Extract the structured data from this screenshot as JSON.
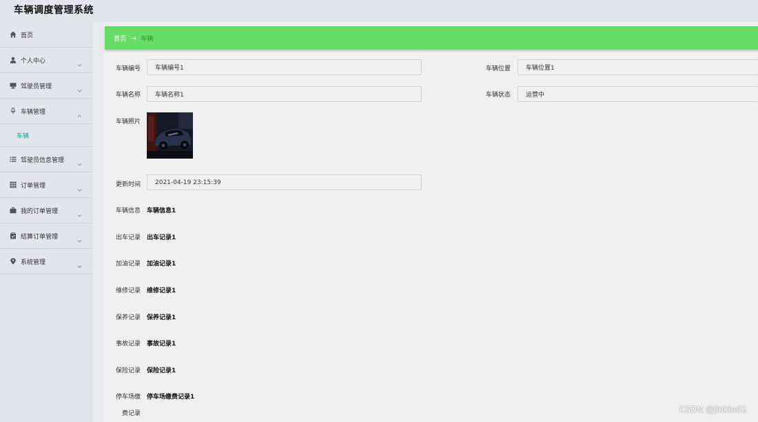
{
  "app": {
    "title": "车辆调度管理系统"
  },
  "sidebar": {
    "items": [
      {
        "label": "首页",
        "icon": "home-icon"
      },
      {
        "label": "个人中心",
        "icon": "user-icon"
      },
      {
        "label": "驾驶员管理",
        "icon": "monitor-icon"
      },
      {
        "label": "车辆管理",
        "icon": "microphone-icon"
      },
      {
        "label": "车辆",
        "sub": true
      },
      {
        "label": "驾驶员信息管理",
        "icon": "list-icon"
      },
      {
        "label": "订单管理",
        "icon": "grid-icon"
      },
      {
        "label": "我的订单管理",
        "icon": "briefcase-icon"
      },
      {
        "label": "结算订单管理",
        "icon": "clipboard-icon"
      },
      {
        "label": "系统管理",
        "icon": "location-pin-icon"
      }
    ]
  },
  "breadcrumb": {
    "home": "首页",
    "arrow": "→",
    "current": "车辆"
  },
  "form": {
    "vehicle_no": {
      "label": "车辆编号",
      "value": "车辆编号1"
    },
    "vehicle_pos": {
      "label": "车辆位置",
      "value": "车辆位置1"
    },
    "vehicle_name": {
      "label": "车辆名称",
      "value": "车辆名称1"
    },
    "vehicle_status": {
      "label": "车辆状态",
      "value": "运营中"
    },
    "vehicle_photo": {
      "label": "车辆照片"
    },
    "update_time": {
      "label": "更新时间",
      "value": "2021-04-19 23:15:39"
    },
    "vehicle_info": {
      "label": "车辆信息",
      "value": "车辆信息1"
    },
    "departure": {
      "label": "出车记录",
      "value": "出车记录1"
    },
    "refuel": {
      "label": "加油记录",
      "value": "加油记录1"
    },
    "repair": {
      "label": "维修记录",
      "value": "维修记录1"
    },
    "maintain": {
      "label": "保养记录",
      "value": "保养记录1"
    },
    "accident": {
      "label": "事故记录",
      "value": "事故记录1"
    },
    "insurance": {
      "label": "保险记录",
      "value": "保险记录1"
    },
    "parking": {
      "label_line1": "停车场缴",
      "label_line2": "费记录",
      "value": "停车场缴费记录1"
    }
  },
  "watermark": "CSDN @jinkin02",
  "colors": {
    "breadcrumb_bg": "#66dd66",
    "active_sub": "#1aa392"
  }
}
